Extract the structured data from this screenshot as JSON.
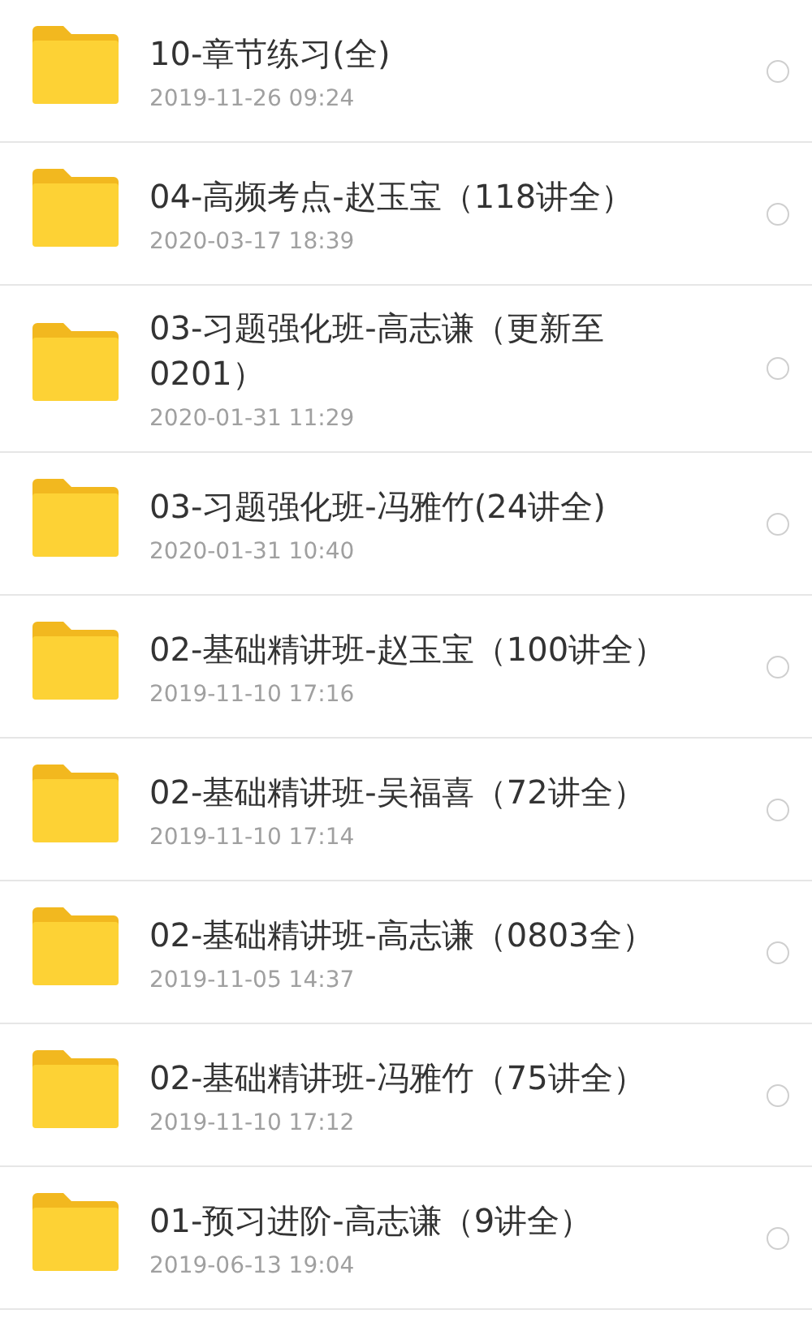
{
  "folders": [
    {
      "name": "10-章节练习(全)",
      "date": "2019-11-26  09:24",
      "selected": false
    },
    {
      "name": "04-高频考点-赵玉宝（118讲全）",
      "date": "2020-03-17  18:39",
      "selected": false
    },
    {
      "name": "03-习题强化班-高志谦（更新至0201）",
      "date": "2020-01-31  11:29",
      "selected": false
    },
    {
      "name": "03-习题强化班-冯雅竹(24讲全)",
      "date": "2020-01-31  10:40",
      "selected": false
    },
    {
      "name": "02-基础精讲班-赵玉宝（100讲全）",
      "date": "2019-11-10  17:16",
      "selected": false
    },
    {
      "name": "02-基础精讲班-吴福喜（72讲全）",
      "date": "2019-11-10  17:14",
      "selected": false
    },
    {
      "name": "02-基础精讲班-高志谦（0803全）",
      "date": "2019-11-05  14:37",
      "selected": false
    },
    {
      "name": "02-基础精讲班-冯雅竹（75讲全）",
      "date": "2019-11-10  17:12",
      "selected": false
    },
    {
      "name": "01-预习进阶-高志谦（9讲全）",
      "date": "2019-06-13  19:04",
      "selected": false
    }
  ]
}
